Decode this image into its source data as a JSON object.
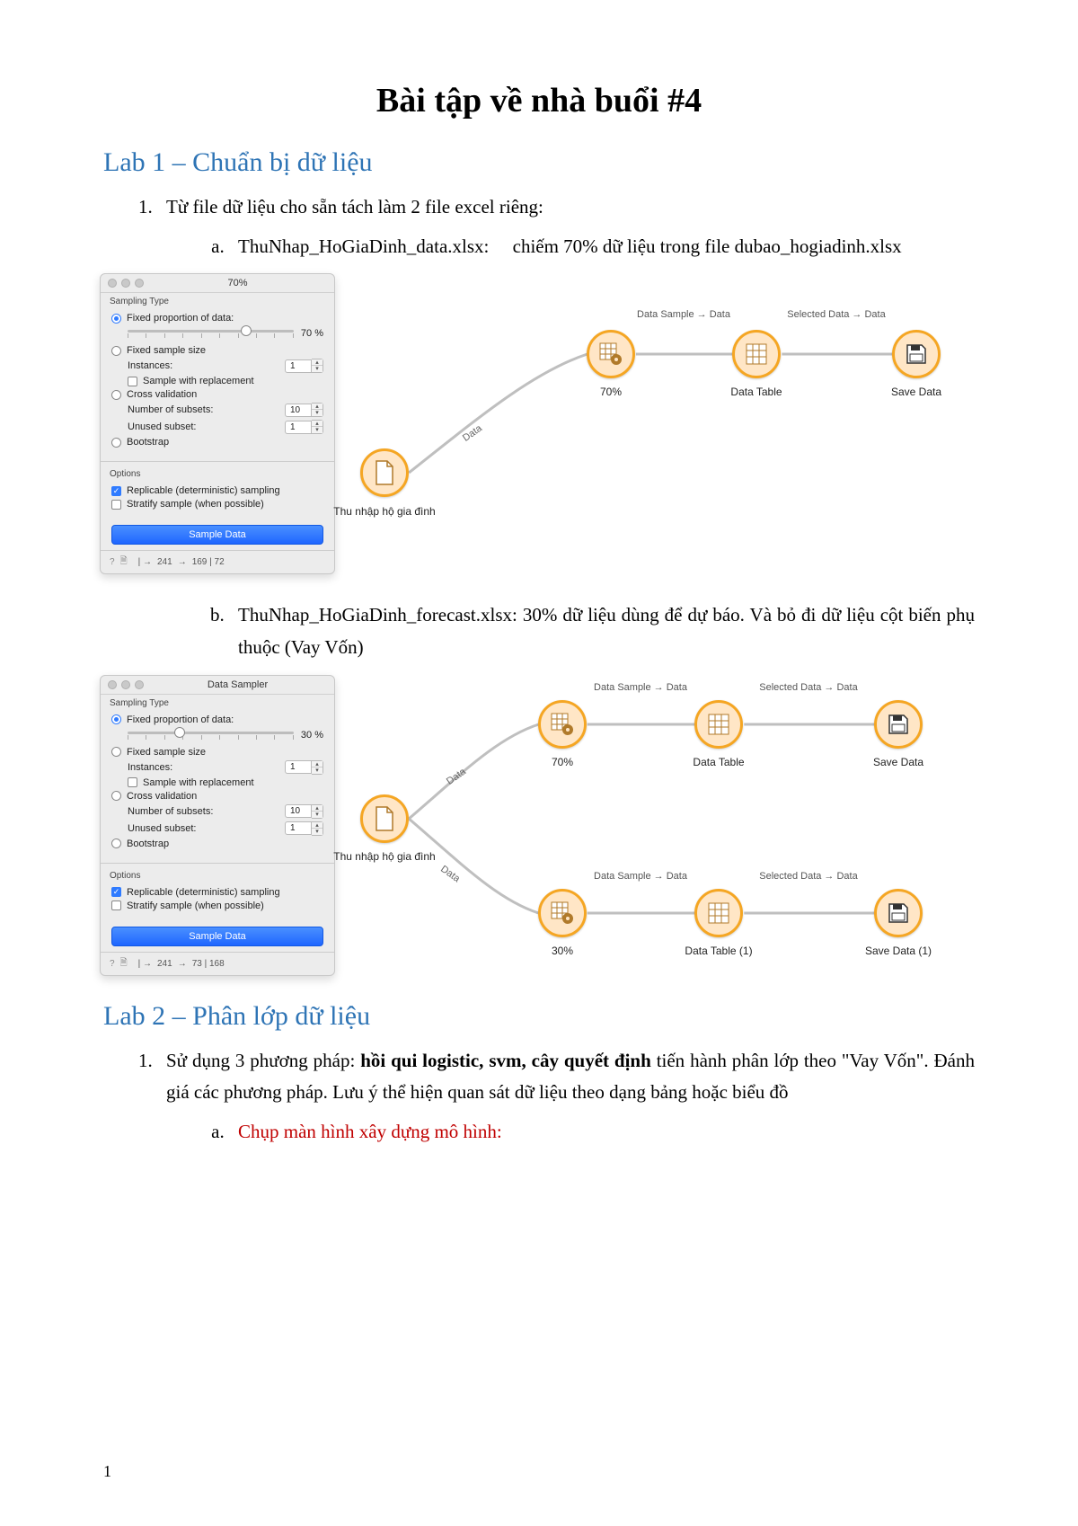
{
  "title": "Bài tập về nhà buổi #4",
  "lab1": {
    "heading": "Lab 1 – Chuẩn bị dữ liệu",
    "item1": "Từ file dữ liệu cho sẵn tách làm 2 file excel riêng:",
    "item1a_file": "ThuNhap_HoGiaDinh_data.xlsx:",
    "item1a_rest": "chiếm 70% dữ liệu trong file dubao_hogiadinh.xlsx",
    "item1b": "ThuNhap_HoGiaDinh_forecast.xlsx: 30% dữ liệu dùng để dự báo. Và bỏ đi dữ liệu cột biến phụ thuộc (Vay Vốn)"
  },
  "lab2": {
    "heading": "Lab 2 – Phân lớp dữ liệu",
    "item1_pre": "Sử dụng 3 phương pháp: ",
    "item1_bold": "hồi qui logistic, svm, cây quyết định",
    "item1_post": " tiến hành phân lớp theo \"Vay Vốn\". Đánh giá các phương pháp. Lưu ý thể hiện quan sát dữ liệu theo dạng bảng hoặc biểu đồ",
    "item1a": "Chụp màn hình xây dựng mô hình:"
  },
  "panel_common": {
    "sampling_type": "Sampling Type",
    "fixed_prop": "Fixed proportion of data:",
    "fixed_size": "Fixed sample size",
    "instances": "Instances:",
    "sample_replace": "Sample with replacement",
    "cross_val": "Cross validation",
    "num_subsets": "Number of subsets:",
    "unused_subset": "Unused subset:",
    "bootstrap": "Bootstrap",
    "options": "Options",
    "replicable": "Replicable (deterministic) sampling",
    "stratify": "Stratify sample (when possible)",
    "sample_btn": "Sample Data",
    "instances_val": "1",
    "subsets_val": "10",
    "unused_val": "1"
  },
  "panel1": {
    "title": "70%",
    "prop_pct": "70 %",
    "status": "241",
    "status2": "169 | 72"
  },
  "panel2": {
    "title": "Data Sampler",
    "prop_pct": "30 %",
    "status": "241",
    "status2": "73 | 168"
  },
  "workflow": {
    "data_link": "Data",
    "ds_data": "Data Sample → Data",
    "sel_data": "Selected Data → Data",
    "thu_nhap": "Thu nhập hộ gia đình",
    "pct70": "70%",
    "pct30": "30%",
    "data_table": "Data Table",
    "data_table1": "Data Table (1)",
    "save_data": "Save Data",
    "save_data1": "Save Data (1)"
  },
  "page_number": "1"
}
